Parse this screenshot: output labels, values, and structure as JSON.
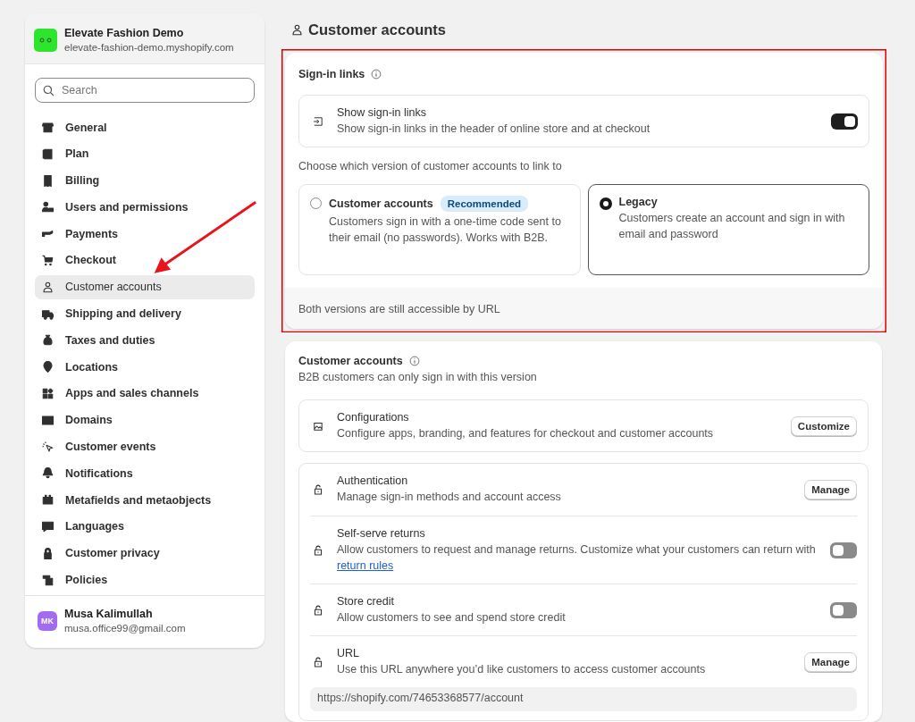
{
  "store": {
    "name": "Elevate Fashion Demo",
    "domain": "elevate-fashion-demo.myshopify.com"
  },
  "search": {
    "placeholder": "Search"
  },
  "sidebar": {
    "items": [
      {
        "label": "General",
        "selected": false
      },
      {
        "label": "Plan",
        "selected": false
      },
      {
        "label": "Billing",
        "selected": false
      },
      {
        "label": "Users and permissions",
        "selected": false
      },
      {
        "label": "Payments",
        "selected": false
      },
      {
        "label": "Checkout",
        "selected": false
      },
      {
        "label": "Customer accounts",
        "selected": true
      },
      {
        "label": "Shipping and delivery",
        "selected": false
      },
      {
        "label": "Taxes and duties",
        "selected": false
      },
      {
        "label": "Locations",
        "selected": false
      },
      {
        "label": "Apps and sales channels",
        "selected": false
      },
      {
        "label": "Domains",
        "selected": false
      },
      {
        "label": "Customer events",
        "selected": false
      },
      {
        "label": "Notifications",
        "selected": false
      },
      {
        "label": "Metafields and metaobjects",
        "selected": false
      },
      {
        "label": "Languages",
        "selected": false
      },
      {
        "label": "Customer privacy",
        "selected": false
      },
      {
        "label": "Policies",
        "selected": false
      }
    ]
  },
  "user": {
    "initials": "MK",
    "name": "Musa Kalimullah",
    "email": "musa.office99@gmail.com"
  },
  "page_title": "Customer accounts",
  "sign_in_card": {
    "title": "Sign-in links",
    "setting": {
      "title": "Show sign-in links",
      "description": "Show sign-in links in the header of online store and at checkout",
      "on": true
    },
    "prompt": "Choose which version of customer accounts to link to",
    "options": [
      {
        "title": "Customer accounts",
        "badge": "Recommended",
        "description": "Customers sign in with a one-time code sent to their email (no passwords). Works with B2B.",
        "selected": false
      },
      {
        "title": "Legacy",
        "description": "Customers create an account and sign in with email and password",
        "selected": true
      }
    ],
    "footer": "Both versions are still accessible by URL"
  },
  "accounts_card": {
    "title": "Customer accounts",
    "subtitle": "B2B customers can only sign in with this version",
    "config": {
      "title": "Configurations",
      "description": "Configure apps, branding, and features for checkout and customer accounts",
      "button": "Customize"
    },
    "rows": [
      {
        "kind": "button",
        "title": "Authentication",
        "description": "Manage sign-in methods and account access",
        "button": "Manage"
      },
      {
        "kind": "toggle",
        "title": "Self-serve returns",
        "description": "Allow customers to request and manage returns. Customize what your customers can return with",
        "link": "return rules",
        "on": false
      },
      {
        "kind": "toggle",
        "title": "Store credit",
        "description": "Allow customers to see and spend store credit",
        "on": false
      },
      {
        "kind": "button",
        "title": "URL",
        "description": "Use this URL anywhere you’d like customers to access customer accounts",
        "button": "Manage",
        "url": "https://shopify.com/74653368577/account"
      }
    ]
  }
}
